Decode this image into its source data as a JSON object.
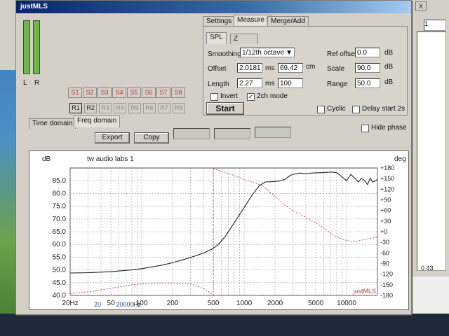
{
  "app": {
    "title": "justMLS"
  },
  "meters": {
    "left_label": "L",
    "right_label": "R"
  },
  "sample_buttons": [
    "S1",
    "S2",
    "S3",
    "S4",
    "S5",
    "S6",
    "S7",
    "S8"
  ],
  "ref_buttons": [
    "R1",
    "R2",
    "R3",
    "R4",
    "R5",
    "R6",
    "R7",
    "R8"
  ],
  "left_tabs": [
    "Time domain",
    "Freq domain"
  ],
  "top_tabs": [
    "Settings",
    "Measure !",
    "Merge/Add"
  ],
  "sub_tabs": [
    "SPL",
    "Z"
  ],
  "measure": {
    "smoothing_label": "Smoothing",
    "smoothing_value": "1/12th octave",
    "offset_label": "Offset",
    "offset_ms": "2.0181",
    "offset_ms_unit": "ms",
    "offset_cm": "69.42",
    "offset_cm_unit": "cm",
    "length_label": "Length",
    "length_ms": "2.27",
    "length_ms_unit": "ms",
    "length_n": "100",
    "invert_label": "Invert",
    "twoch_label": "2ch mode",
    "start_label": "Start",
    "cyclic_label": "Cyclic",
    "delay_label": "Delay start 2s",
    "ref_offset_label": "Ref offset",
    "ref_offset_value": "0.0",
    "scale_label": "Scale",
    "scale_value": "90.0",
    "range_label": "Range",
    "range_value": "50.0",
    "db_unit": "dB"
  },
  "toolbar": {
    "export_label": "Export",
    "copy_label": "Copy",
    "hide_phase_label": "Hide phase"
  },
  "right_panel": {
    "close": "X",
    "combo": "1",
    "readout": "0 43"
  },
  "chart_data": {
    "type": "line",
    "title": "tw audio labs 1",
    "watermark": "justMLS",
    "ylabel": "dB",
    "y2label": "deg",
    "xlabel": "Hz",
    "x_scale": "log",
    "xlim": [
      20,
      20000
    ],
    "ylim": [
      40,
      90
    ],
    "y2lim": [
      -180,
      180
    ],
    "x_range_left": "20",
    "x_range_right": "20000",
    "x_ticks": [
      20,
      50,
      100,
      200,
      500,
      1000,
      2000,
      5000,
      10000
    ],
    "x_tick_labels": [
      "20Hz",
      "50",
      "100",
      "200",
      "500",
      "1000",
      "2000",
      "5000",
      "10000"
    ],
    "y_ticks": [
      40,
      45,
      50,
      55,
      60,
      65,
      70,
      75,
      80,
      85
    ],
    "y_tick_labels": [
      "40.0",
      "45.0",
      "50.0",
      "55.0",
      "60.0",
      "65.0",
      "70.0",
      "75.0",
      "80.0",
      "85.0"
    ],
    "y2_ticks": [
      -180,
      -150,
      -120,
      -90,
      -60,
      -30,
      0,
      30,
      60,
      90,
      120,
      150,
      180
    ],
    "y2_tick_labels": [
      "-180",
      "-150",
      "-120",
      "-90",
      "-60",
      "-30",
      "+0",
      "+30",
      "+60",
      "+90",
      "+120",
      "+150",
      "+180"
    ],
    "grid": true,
    "series": [
      {
        "color": "#222222",
        "axis": "left",
        "x": [
          20,
          30,
          50,
          80,
          100,
          150,
          200,
          300,
          400,
          480,
          550,
          650,
          800,
          1000,
          1200,
          1400,
          1600,
          1800,
          2000,
          2200,
          2500,
          2800,
          3000,
          3500,
          4000,
          4500,
          5000,
          6000,
          7000,
          8000,
          9000,
          10000,
          11000,
          12000,
          13000,
          14000,
          15000,
          16000,
          17000,
          18000,
          20000
        ],
        "y": [
          48.8,
          48.9,
          49.3,
          50.0,
          50.5,
          51.7,
          52.8,
          54.9,
          56.6,
          58.1,
          59.7,
          63.0,
          68.5,
          74.5,
          79.5,
          83.0,
          84.5,
          84.6,
          84.7,
          84.9,
          85.5,
          87.0,
          87.5,
          88.0,
          87.8,
          88.0,
          88.1,
          88.2,
          88.4,
          88.2,
          86.5,
          85.0,
          87.5,
          86.0,
          84.5,
          86.0,
          85.0,
          83.5,
          86.0,
          84.5,
          85.5
        ]
      },
      {
        "color": "#c04040",
        "axis": "right",
        "dashed": true,
        "x": [
          20,
          30,
          50,
          80,
          100,
          150,
          200,
          300,
          400,
          500
        ],
        "y": [
          -175,
          -170,
          -160,
          -150,
          -148,
          -145,
          -145,
          -148,
          -160,
          -178
        ]
      },
      {
        "color": "#c04040",
        "axis": "right",
        "dashed": true,
        "x": [
          500,
          700,
          1000,
          1500,
          2000,
          2500,
          3000,
          4000,
          5000,
          6000,
          7000,
          8000,
          10000,
          12000,
          15000,
          20000
        ],
        "y": [
          178,
          165,
          148,
          130,
          100,
          75,
          60,
          40,
          25,
          10,
          -5,
          -15,
          -25,
          -28,
          -22,
          -15
        ]
      }
    ]
  }
}
